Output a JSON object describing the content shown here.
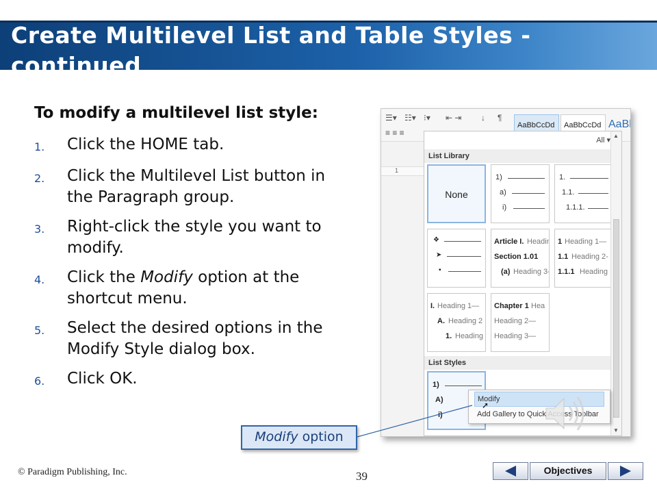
{
  "title": "Create Multilevel List and Table Styles - continued",
  "lead": "To modify a multilevel list style:",
  "steps": [
    {
      "num": "1.",
      "text": "Click the HOME tab."
    },
    {
      "num": "2.",
      "text": "Click the Multilevel List button in the Paragraph group."
    },
    {
      "num": "3.",
      "text": "Right-click the style you want to modify."
    },
    {
      "num": "4.",
      "pre": "Click the ",
      "em": "Modify",
      "post": " option at the shortcut menu."
    },
    {
      "num": "5.",
      "text": "Select the desired options in the Modify Style dialog box."
    },
    {
      "num": "6.",
      "text": "Click OK."
    }
  ],
  "screenshot": {
    "ribbon": {
      "style_samples": [
        "AaBbCcDd",
        "AaBbCcDd",
        "AaBl"
      ],
      "pilcrow": "¶",
      "ruler_mark": "1"
    },
    "gallery": {
      "filter": "All",
      "list_library_header": "List Library",
      "list_styles_header": "List Styles",
      "none_label": "None",
      "tile_numbered": [
        "1)",
        "a)",
        "i)"
      ],
      "tile_decimal": [
        "1.",
        "1.1.",
        "1.1.1."
      ],
      "tile_article": [
        "Article I.",
        "Heading",
        "Section 1.01",
        "(a)",
        "Heading 3-"
      ],
      "tile_heading_num": [
        "1",
        "Heading 1—",
        "1.1",
        "Heading 2-",
        "1.1.1",
        "Heading"
      ],
      "tile_roman": [
        "I.",
        "Heading 1—",
        "A.",
        "Heading 2",
        "1.",
        "Heading"
      ],
      "tile_chapter": [
        "Chapter 1",
        "Hea",
        "Heading 2—",
        "Heading 3—"
      ],
      "tile_style": [
        "1)",
        "A)",
        "i)"
      ]
    },
    "context_menu": {
      "modify": "Modify",
      "add_gallery": "Add Gallery to Quick Access Toolbar"
    }
  },
  "callout": {
    "em": "Modify",
    "rest": " option"
  },
  "footer": {
    "copyright": "© Paradigm Publishing, Inc.",
    "page_number": "39",
    "objectives": "Objectives"
  },
  "colors": {
    "banner_dark": "#0d3f78",
    "banner_light": "#6aa6dd",
    "callout_border": "#2f64a8",
    "nav_arrow": "#1e3f7c"
  }
}
